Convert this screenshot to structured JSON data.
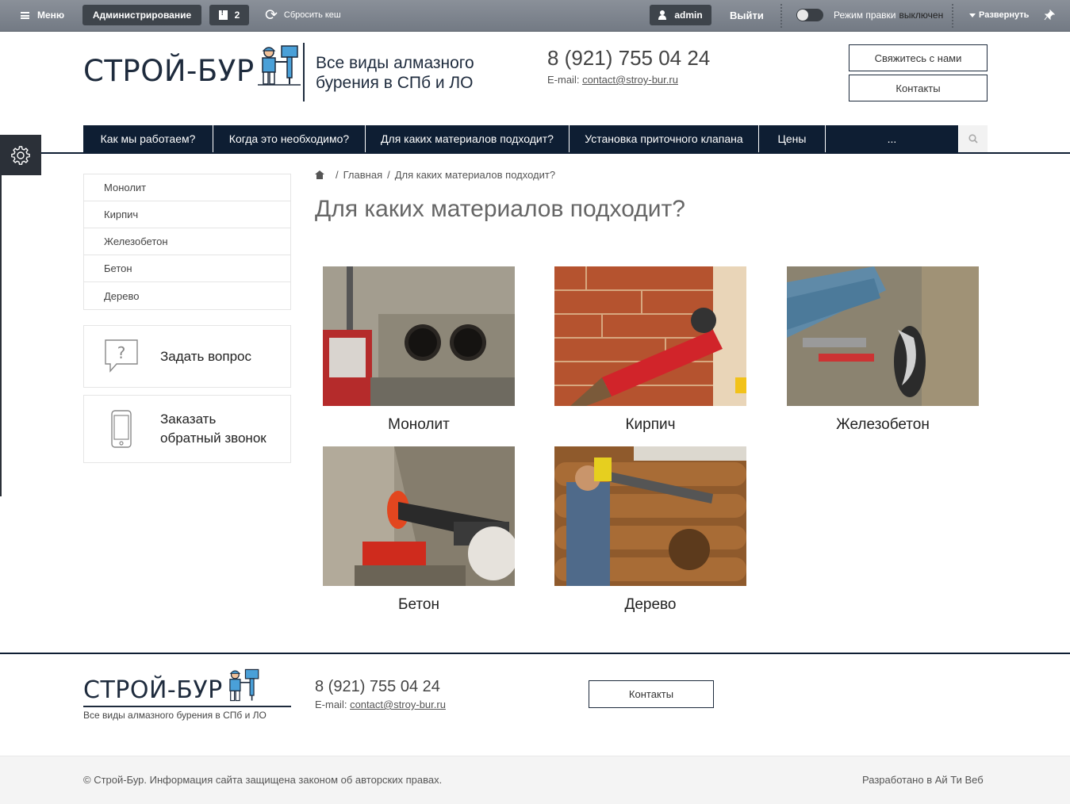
{
  "adminbar": {
    "menu": "Меню",
    "admin": "Администрирование",
    "notifications": "2",
    "cache": "Сбросить кеш",
    "user": "admin",
    "logout": "Выйти",
    "edit_mode": "Режим правки",
    "edit_state": "выключен",
    "expand": "Развернуть"
  },
  "header": {
    "logo": "СТРОЙ-БУР",
    "tagline": "Все виды алмазного бурения в СПб и ЛО",
    "phone": "8 (921) 755 04 24",
    "email_label": "E-mail:",
    "email": "contact@stroy-bur.ru",
    "contact_us": "Свяжитесь с нами",
    "contacts": "Контакты"
  },
  "nav": [
    {
      "label": "Как мы работаем?"
    },
    {
      "label": "Когда это необходимо?"
    },
    {
      "label": "Для каких материалов подходит?"
    },
    {
      "label": "Установка приточного клапана"
    },
    {
      "label": "Цены"
    },
    {
      "label": "..."
    }
  ],
  "sidebar": {
    "items": [
      {
        "label": "Монолит"
      },
      {
        "label": "Кирпич"
      },
      {
        "label": "Железобетон"
      },
      {
        "label": "Бетон"
      },
      {
        "label": "Дерево"
      }
    ],
    "ask": "Задать вопрос",
    "callback": "Заказать обратный звонок"
  },
  "breadcrumbs": {
    "home": "Главная",
    "current": "Для каких материалов подходит?"
  },
  "main": {
    "title": "Для каких материалов подходит?",
    "tiles": [
      {
        "caption": "Монолит"
      },
      {
        "caption": "Кирпич"
      },
      {
        "caption": "Железобетон"
      },
      {
        "caption": "Бетон"
      },
      {
        "caption": "Дерево"
      }
    ]
  },
  "footer": {
    "logo": "СТРОЙ-БУР",
    "tagline": "Все виды алмазного бурения в СПб и ЛО",
    "phone": "8 (921) 755 04 24",
    "email_label": "E-mail:",
    "email": "contact@stroy-bur.ru",
    "contacts": "Контакты",
    "copyright": "© Строй-Бур. Информация сайта защищена законом об авторских правах.",
    "developer": "Разработано в Ай Ти Веб"
  },
  "colors": {
    "brand": "#0e1e33",
    "adminbar": "#7d838c"
  }
}
